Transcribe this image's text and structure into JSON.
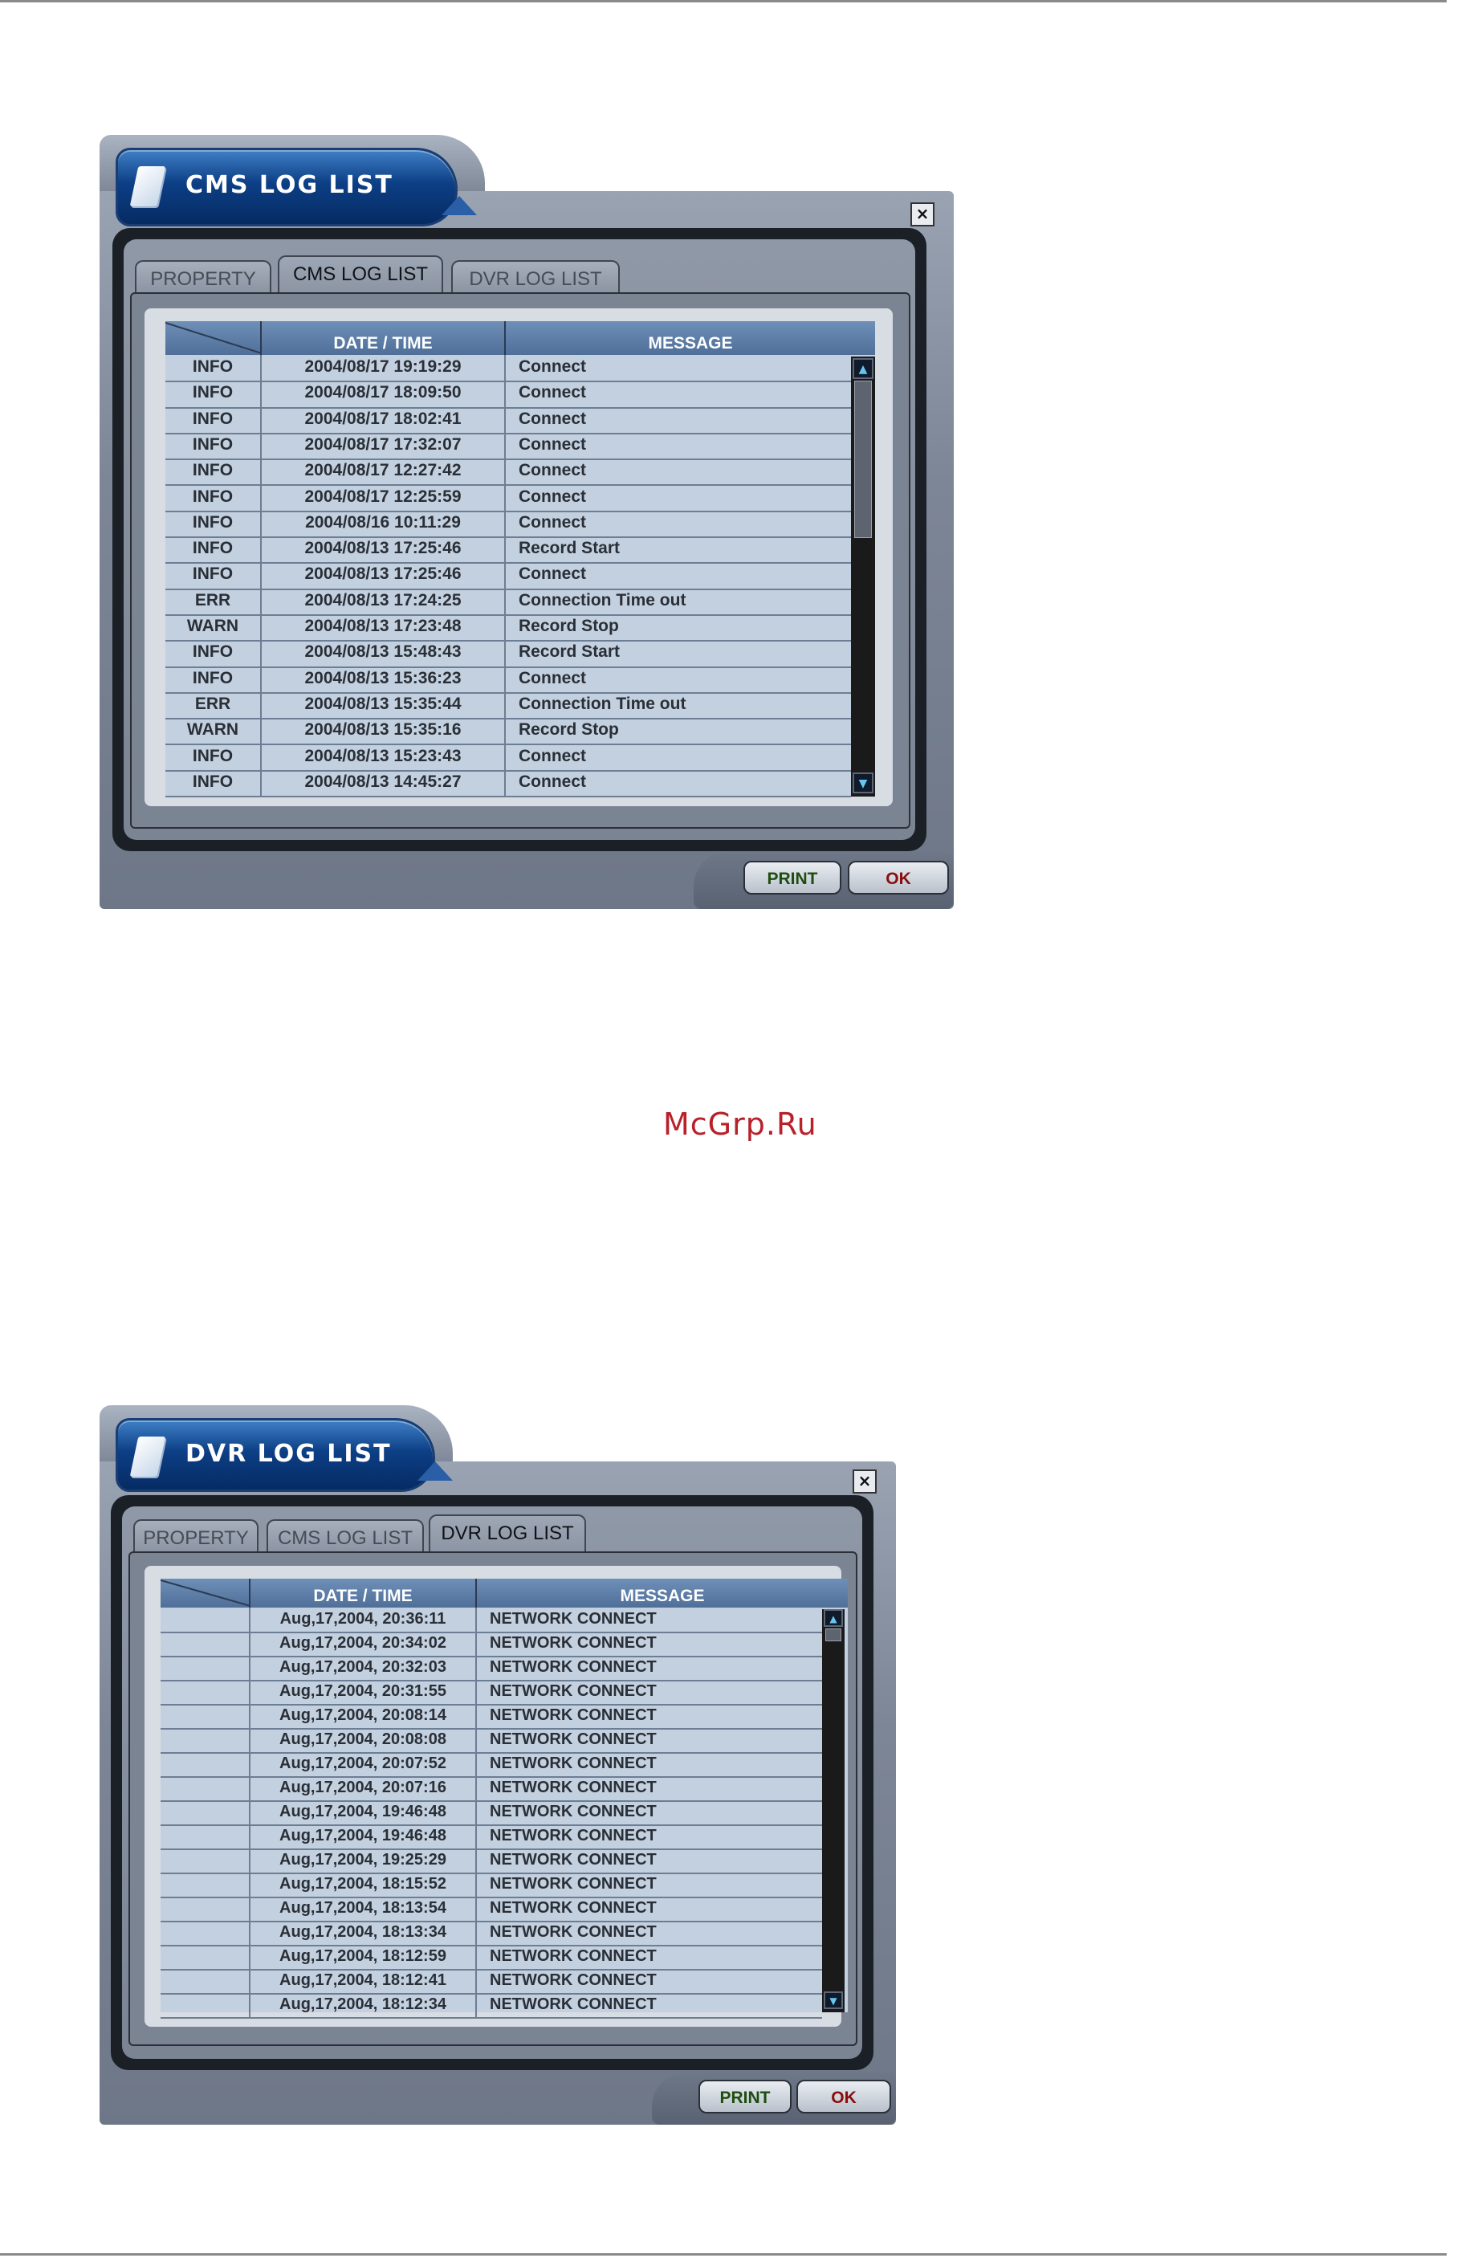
{
  "watermark": "McGrp.Ru",
  "colors": {
    "title_blue": "#0c3f85",
    "header_blue": "#4f6f99",
    "row_bg": "#c3d0df",
    "print_text": "#1e4d10",
    "ok_text": "#8a0d0d"
  },
  "cms_window": {
    "title": "CMS LOG LIST",
    "tabs": [
      {
        "label": "PROPERTY",
        "active": false
      },
      {
        "label": "CMS LOG LIST",
        "active": true
      },
      {
        "label": "DVR LOG LIST",
        "active": false
      }
    ],
    "columns": [
      "",
      "DATE / TIME",
      "MESSAGE"
    ],
    "rows": [
      {
        "level": "INFO",
        "datetime": "2004/08/17 19:19:29",
        "message": "Connect"
      },
      {
        "level": "INFO",
        "datetime": "2004/08/17 18:09:50",
        "message": "Connect"
      },
      {
        "level": "INFO",
        "datetime": "2004/08/17 18:02:41",
        "message": "Connect"
      },
      {
        "level": "INFO",
        "datetime": "2004/08/17 17:32:07",
        "message": "Connect"
      },
      {
        "level": "INFO",
        "datetime": "2004/08/17 12:27:42",
        "message": "Connect"
      },
      {
        "level": "INFO",
        "datetime": "2004/08/17 12:25:59",
        "message": "Connect"
      },
      {
        "level": "INFO",
        "datetime": "2004/08/16 10:11:29",
        "message": "Connect"
      },
      {
        "level": "INFO",
        "datetime": "2004/08/13 17:25:46",
        "message": "Record Start"
      },
      {
        "level": "INFO",
        "datetime": "2004/08/13 17:25:46",
        "message": "Connect"
      },
      {
        "level": "ERR",
        "datetime": "2004/08/13 17:24:25",
        "message": "Connection Time out"
      },
      {
        "level": "WARN",
        "datetime": "2004/08/13 17:23:48",
        "message": "Record Stop"
      },
      {
        "level": "INFO",
        "datetime": "2004/08/13 15:48:43",
        "message": "Record Start"
      },
      {
        "level": "INFO",
        "datetime": "2004/08/13 15:36:23",
        "message": "Connect"
      },
      {
        "level": "ERR",
        "datetime": "2004/08/13 15:35:44",
        "message": "Connection Time out"
      },
      {
        "level": "WARN",
        "datetime": "2004/08/13 15:35:16",
        "message": "Record Stop"
      },
      {
        "level": "INFO",
        "datetime": "2004/08/13 15:23:43",
        "message": "Connect"
      },
      {
        "level": "INFO",
        "datetime": "2004/08/13 14:45:27",
        "message": "Connect"
      }
    ],
    "buttons": {
      "print": "PRINT",
      "ok": "OK"
    },
    "close": "×"
  },
  "dvr_window": {
    "title": "DVR LOG LIST",
    "tabs": [
      {
        "label": "PROPERTY",
        "active": false
      },
      {
        "label": "CMS LOG LIST",
        "active": false
      },
      {
        "label": "DVR LOG LIST",
        "active": true
      }
    ],
    "columns": [
      "",
      "DATE / TIME",
      "MESSAGE"
    ],
    "rows": [
      {
        "level": "",
        "datetime": "Aug,17,2004, 20:36:11",
        "message": "NETWORK CONNECT"
      },
      {
        "level": "",
        "datetime": "Aug,17,2004, 20:34:02",
        "message": "NETWORK CONNECT"
      },
      {
        "level": "",
        "datetime": "Aug,17,2004, 20:32:03",
        "message": "NETWORK CONNECT"
      },
      {
        "level": "",
        "datetime": "Aug,17,2004, 20:31:55",
        "message": "NETWORK CONNECT"
      },
      {
        "level": "",
        "datetime": "Aug,17,2004, 20:08:14",
        "message": "NETWORK CONNECT"
      },
      {
        "level": "",
        "datetime": "Aug,17,2004, 20:08:08",
        "message": "NETWORK CONNECT"
      },
      {
        "level": "",
        "datetime": "Aug,17,2004, 20:07:52",
        "message": "NETWORK CONNECT"
      },
      {
        "level": "",
        "datetime": "Aug,17,2004, 20:07:16",
        "message": "NETWORK CONNECT"
      },
      {
        "level": "",
        "datetime": "Aug,17,2004, 19:46:48",
        "message": "NETWORK CONNECT"
      },
      {
        "level": "",
        "datetime": "Aug,17,2004, 19:46:48",
        "message": "NETWORK CONNECT"
      },
      {
        "level": "",
        "datetime": "Aug,17,2004, 19:25:29",
        "message": "NETWORK CONNECT"
      },
      {
        "level": "",
        "datetime": "Aug,17,2004, 18:15:52",
        "message": "NETWORK CONNECT"
      },
      {
        "level": "",
        "datetime": "Aug,17,2004, 18:13:54",
        "message": "NETWORK CONNECT"
      },
      {
        "level": "",
        "datetime": "Aug,17,2004, 18:13:34",
        "message": "NETWORK CONNECT"
      },
      {
        "level": "",
        "datetime": "Aug,17,2004, 18:12:59",
        "message": "NETWORK CONNECT"
      },
      {
        "level": "",
        "datetime": "Aug,17,2004, 18:12:41",
        "message": "NETWORK CONNECT"
      },
      {
        "level": "",
        "datetime": "Aug,17,2004, 18:12:34",
        "message": "NETWORK CONNECT"
      }
    ],
    "buttons": {
      "print": "PRINT",
      "ok": "OK"
    },
    "close": "×"
  }
}
